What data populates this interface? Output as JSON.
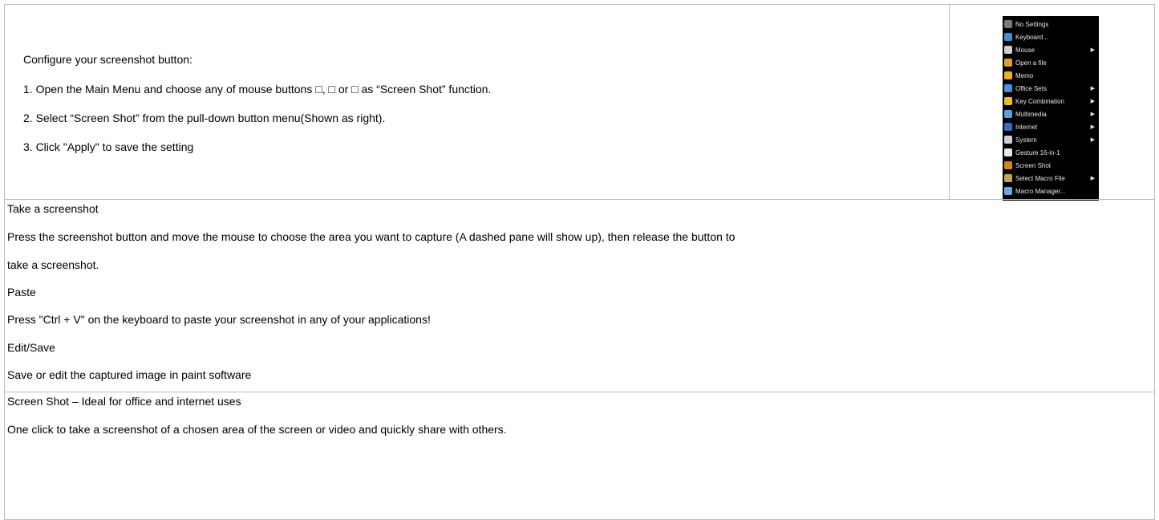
{
  "configure": {
    "heading": "Configure your screenshot button:",
    "steps": [
      "1. Open the Main Menu and choose any of mouse buttons □, □ or □ as “Screen Shot” function.",
      "2. Select “Screen Shot” from the pull-down button menu(Shown as right).",
      "3. Click \"Apply\" to save the setting"
    ]
  },
  "menu": {
    "items": [
      {
        "label": "No Settings",
        "icon": "no-settings-icon",
        "color": "#7a7a7a",
        "submenu": false
      },
      {
        "label": "Keyboard...",
        "icon": "keyboard-icon",
        "color": "#3a8fd8",
        "submenu": false
      },
      {
        "label": "Mouse",
        "icon": "mouse-icon",
        "color": "#cfcfcf",
        "submenu": true
      },
      {
        "label": "Open a file",
        "icon": "folder-icon",
        "color": "#e0a030",
        "submenu": false
      },
      {
        "label": "Memo",
        "icon": "memo-icon",
        "color": "#f0b020",
        "submenu": false
      },
      {
        "label": "Office Sets",
        "icon": "office-icon",
        "color": "#4a90d9",
        "submenu": true
      },
      {
        "label": "Key Combination",
        "icon": "key-combination-icon",
        "color": "#e8c020",
        "submenu": true
      },
      {
        "label": "Multimedia",
        "icon": "multimedia-icon",
        "color": "#5aa0e0",
        "submenu": true
      },
      {
        "label": "Internet",
        "icon": "internet-icon",
        "color": "#3070c0",
        "submenu": true
      },
      {
        "label": "System",
        "icon": "system-icon",
        "color": "#d0d0d0",
        "submenu": true
      },
      {
        "label": "Gesture 16-in-1",
        "icon": "gesture-icon",
        "color": "#e8e8e8",
        "submenu": false
      },
      {
        "label": "Screen Shot",
        "icon": "screen-shot-icon",
        "color": "#e08020",
        "submenu": false
      },
      {
        "label": "Select Macro File",
        "icon": "macro-file-icon",
        "color": "#c8a060",
        "submenu": true
      },
      {
        "label": "Macro Manager...",
        "icon": "macro-manager-icon",
        "color": "#6aa8e8",
        "submenu": false
      }
    ]
  },
  "instructions": {
    "take_heading": "Take a screenshot",
    "take_body_1": "Press the screenshot button and move the mouse to choose the area you want to capture (A dashed pane will show up), then release the button to",
    "take_body_2": "take a screenshot.",
    "paste_heading": "Paste",
    "paste_body": "Press \"Ctrl + V\" on the keyboard to paste your screenshot in any of your applications!",
    "edit_heading": "Edit/Save",
    "edit_body": "Save or edit the captured image in paint software"
  },
  "feature": {
    "title": "Screen Shot – Ideal for office and internet uses",
    "body": "One click to take a screenshot of a chosen area of the screen or video and quickly share with others."
  }
}
